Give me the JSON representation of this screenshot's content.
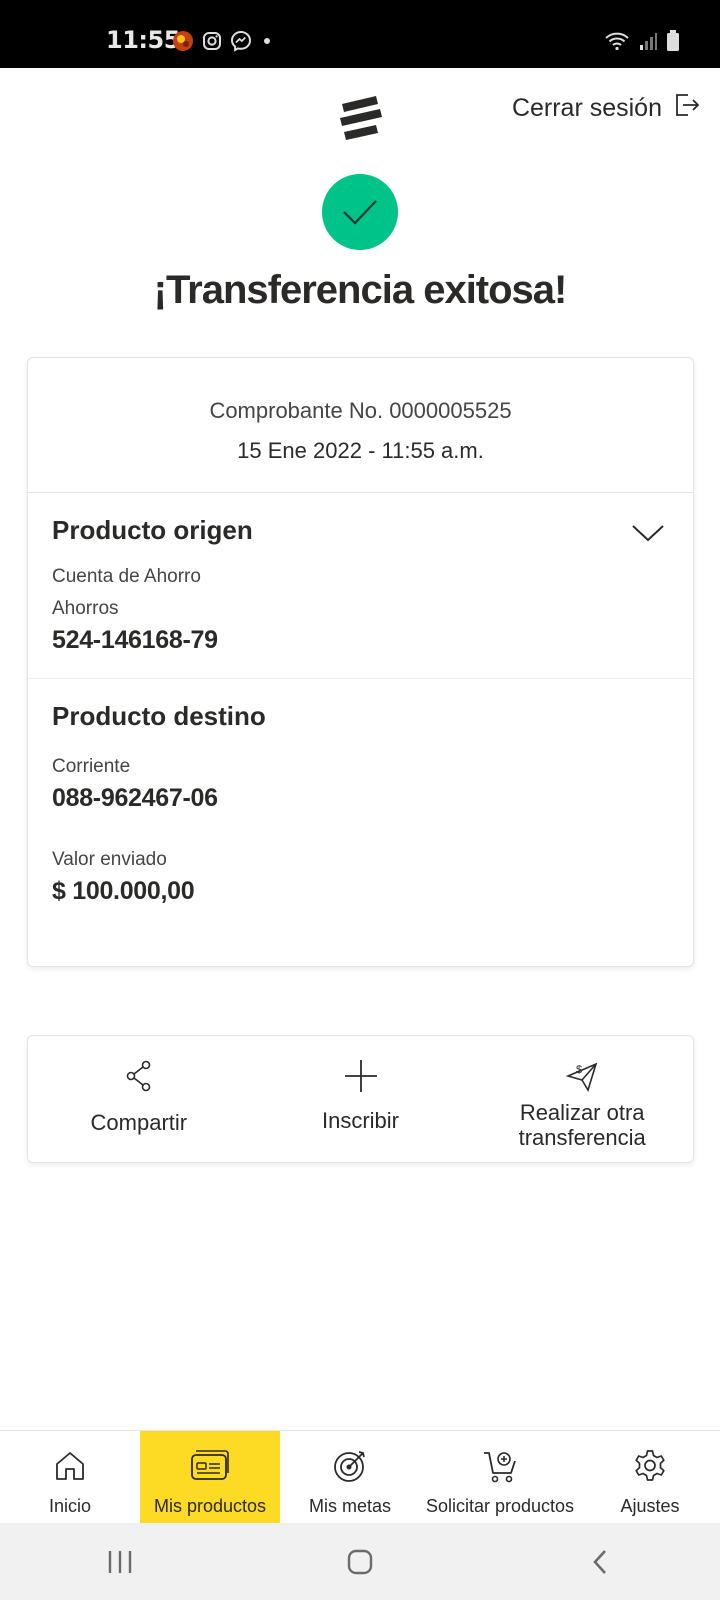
{
  "status_bar": {
    "time": "11:55",
    "left_icons": [
      "game-app-icon",
      "instagram-icon",
      "messenger-icon",
      "dot-icon"
    ],
    "right_icons": [
      "wifi-icon",
      "signal-icon",
      "battery-icon"
    ]
  },
  "header": {
    "logo": "bank-logo-icon",
    "logout_label": "Cerrar sesión",
    "logout_icon": "logout-icon"
  },
  "success": {
    "icon": "check-icon",
    "title": "¡Transferencia exitosa!",
    "color": "#00c389"
  },
  "receipt": {
    "number": "Comprobante No. 0000005525",
    "date": "15 Ene 2022 - 11:55 a.m.",
    "origin": {
      "title": "Producto origen",
      "account_type": "Cuenta de Ahorro",
      "account_subtype": "Ahorros",
      "account_number": "524-146168-79"
    },
    "destination": {
      "title": "Producto destino",
      "account_type": "Corriente",
      "account_number": "088-962467-06",
      "value_label": "Valor enviado",
      "value": "$ 100.000,00"
    }
  },
  "actions": [
    {
      "label": "Compartir",
      "icon": "share-icon"
    },
    {
      "label": "Inscribir",
      "icon": "plus-icon"
    },
    {
      "label": "Realizar otra transferencia",
      "icon": "send-money-icon"
    }
  ],
  "bottom_nav": {
    "accent": "#fdda24",
    "items": [
      {
        "label": "Inicio",
        "icon": "home-icon",
        "active": false
      },
      {
        "label": "Mis productos",
        "icon": "card-icon",
        "active": true
      },
      {
        "label": "Mis metas",
        "icon": "target-icon",
        "active": false
      },
      {
        "label": "Solicitar productos",
        "icon": "cart-add-icon",
        "active": false
      },
      {
        "label": "Ajustes",
        "icon": "gear-icon",
        "active": false
      }
    ]
  }
}
